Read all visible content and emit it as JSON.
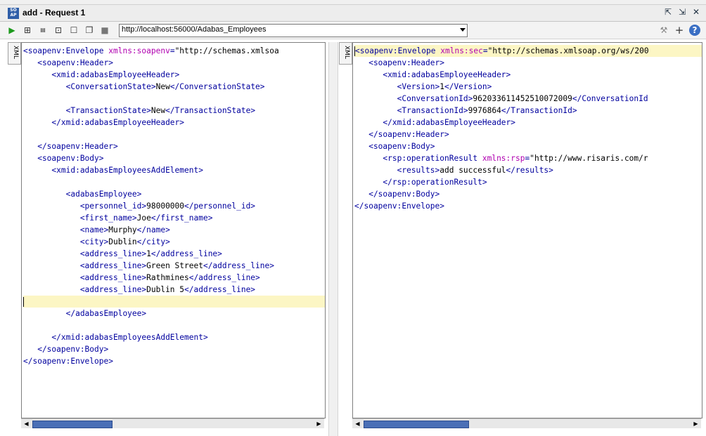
{
  "window": {
    "title": "add - Request 1",
    "logo_text": "SO AP"
  },
  "toolbar": {
    "url": "http://localhost:56000/Adabas_Employees"
  },
  "request": {
    "tab_label": "XML",
    "lines": [
      [
        [
          "tag",
          "<soapenv:Envelope "
        ],
        [
          "attr",
          "xmlns:soapenv"
        ],
        [
          "tag",
          "="
        ],
        [
          "str",
          "\"http://schemas.xmlsoa"
        ]
      ],
      [
        [
          "tag",
          "   <soapenv:Header>"
        ]
      ],
      [
        [
          "tag",
          "      <xmid:adabasEmployeeHeader>"
        ]
      ],
      [
        [
          "tag",
          "         <ConversationState>"
        ],
        [
          "txt",
          "New"
        ],
        [
          "tag",
          "</ConversationState>"
        ]
      ],
      [],
      [
        [
          "tag",
          "         <TransactionState>"
        ],
        [
          "txt",
          "New"
        ],
        [
          "tag",
          "</TransactionState>"
        ]
      ],
      [
        [
          "tag",
          "      </xmid:adabasEmployeeHeader>"
        ]
      ],
      [],
      [
        [
          "tag",
          "   </soapenv:Header>"
        ]
      ],
      [
        [
          "tag",
          "   <soapenv:Body>"
        ]
      ],
      [
        [
          "tag",
          "      <xmid:adabasEmployeesAddElement>"
        ]
      ],
      [],
      [
        [
          "tag",
          "         <adabasEmployee>"
        ]
      ],
      [
        [
          "tag",
          "            <personnel_id>"
        ],
        [
          "txt",
          "98000000"
        ],
        [
          "tag",
          "</personnel_id>"
        ]
      ],
      [
        [
          "tag",
          "            <first_name>"
        ],
        [
          "txt",
          "Joe"
        ],
        [
          "tag",
          "</first_name>"
        ]
      ],
      [
        [
          "tag",
          "            <name>"
        ],
        [
          "txt",
          "Murphy"
        ],
        [
          "tag",
          "</name>"
        ]
      ],
      [
        [
          "tag",
          "            <city>"
        ],
        [
          "txt",
          "Dublin"
        ],
        [
          "tag",
          "</city>"
        ]
      ],
      [
        [
          "tag",
          "            <address_line>"
        ],
        [
          "txt",
          "1"
        ],
        [
          "tag",
          "</address_line>"
        ]
      ],
      [
        [
          "tag",
          "            <address_line>"
        ],
        [
          "txt",
          "Green Street"
        ],
        [
          "tag",
          "</address_line>"
        ]
      ],
      [
        [
          "tag",
          "            <address_line>"
        ],
        [
          "txt",
          "Rathmines"
        ],
        [
          "tag",
          "</address_line>"
        ]
      ],
      [
        [
          "tag",
          "            <address_line>"
        ],
        [
          "txt",
          "Dublin 5"
        ],
        [
          "tag",
          "</address_line>"
        ]
      ],
      [],
      [
        [
          "tag",
          "         </adabasEmployee>"
        ]
      ],
      [],
      [
        [
          "tag",
          "      </xmid:adabasEmployeesAddElement>"
        ]
      ],
      [
        [
          "tag",
          "   </soapenv:Body>"
        ]
      ],
      [
        [
          "tag",
          "</soapenv:Envelope>"
        ]
      ]
    ]
  },
  "response": {
    "tab_label": "XML",
    "lines": [
      [
        [
          "tag",
          "<soapenv:Envelope "
        ],
        [
          "attr",
          "xmlns:sec"
        ],
        [
          "tag",
          "="
        ],
        [
          "str",
          "\"http://schemas.xmlsoap.org/ws/200"
        ]
      ],
      [
        [
          "tag",
          "   <soapenv:Header>"
        ]
      ],
      [
        [
          "tag",
          "      <xmid:adabasEmployeeHeader>"
        ]
      ],
      [
        [
          "tag",
          "         <Version>"
        ],
        [
          "txt",
          "1"
        ],
        [
          "tag",
          "</Version>"
        ]
      ],
      [
        [
          "tag",
          "         <ConversationId>"
        ],
        [
          "txt",
          "962033611452510072009"
        ],
        [
          "tag",
          "</ConversationId"
        ]
      ],
      [
        [
          "tag",
          "         <TransactionId>"
        ],
        [
          "txt",
          "9976864"
        ],
        [
          "tag",
          "</TransactionId>"
        ]
      ],
      [
        [
          "tag",
          "      </xmid:adabasEmployeeHeader>"
        ]
      ],
      [
        [
          "tag",
          "   </soapenv:Header>"
        ]
      ],
      [
        [
          "tag",
          "   <soapenv:Body>"
        ]
      ],
      [
        [
          "tag",
          "      <rsp:operationResult "
        ],
        [
          "attr",
          "xmlns:rsp"
        ],
        [
          "tag",
          "="
        ],
        [
          "str",
          "\"http://www.risaris.com/r"
        ]
      ],
      [
        [
          "tag",
          "         <results>"
        ],
        [
          "txt",
          "add successful"
        ],
        [
          "tag",
          "</results>"
        ]
      ],
      [
        [
          "tag",
          "      </rsp:operationResult>"
        ]
      ],
      [
        [
          "tag",
          "   </soapenv:Body>"
        ]
      ],
      [
        [
          "tag",
          "</soapenv:Envelope>"
        ]
      ]
    ]
  },
  "colors": {
    "tag": "#00009e",
    "attr": "#b000b0",
    "highlight": "#fcf6c4",
    "scroll_thumb": "#4a6fb6"
  }
}
